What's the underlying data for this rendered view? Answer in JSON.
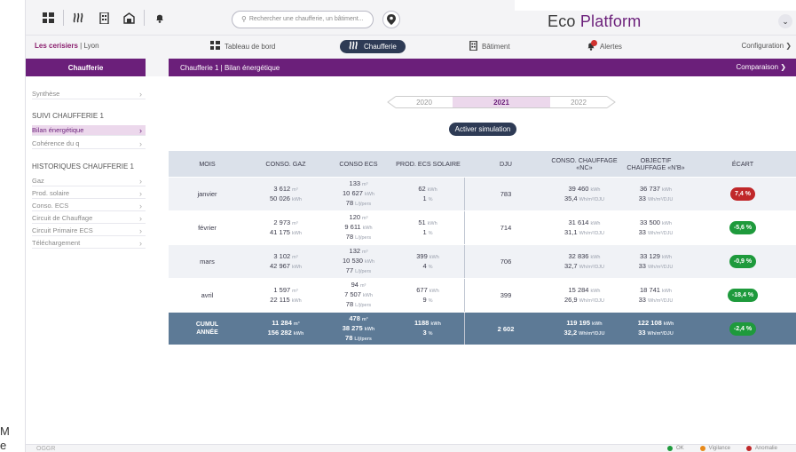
{
  "left_fragment": {
    "line1": "M",
    "line2": "e"
  },
  "topbar": {
    "search_placeholder": "Rechercher une chaufferie, un bâtiment...",
    "brand_eco": "Eco",
    "brand_platform": "Platform"
  },
  "navbar": {
    "site_name": "Les cerisiers",
    "site_city": "| Lyon",
    "items": [
      {
        "label": "Tableau de bord"
      },
      {
        "label": "Chaufferie"
      },
      {
        "label": "Bâtiment"
      },
      {
        "label": "Alertes"
      }
    ],
    "config_label": "Configuration"
  },
  "sidebar": {
    "header": "Chaufferie",
    "synthese": "Synthèse",
    "suivi_head": "SUIVI CHAUFFERIE 1",
    "bilan": "Bilan énergétique",
    "coherence": "Cohérence du q",
    "hist_head": "HISTORIQUES CHAUFFERIE 1",
    "hist_items": [
      "Gaz",
      "Prod. solaire",
      "Conso. ECS",
      "Circuit de Chauffage",
      "Circuit Primaire ECS",
      "Téléchargement"
    ]
  },
  "main": {
    "title": "Chaufferie 1 | Bilan énergétique",
    "compare": "Comparaison",
    "years": [
      "2020",
      "2021",
      "2022"
    ],
    "simulate": "Activer simulation"
  },
  "table": {
    "headers": [
      "MOIS",
      "CONSO. GAZ",
      "CONSO ECS",
      "PROD. ECS SOLAIRE",
      "DJU",
      "CONSO. CHAUFFAGE «NC»",
      "OBJECTIF CHAUFFAGE «N'B»",
      "ÉCART"
    ],
    "rows": [
      {
        "mois": "janvier",
        "gaz_m3": "3 612",
        "gaz_kwh": "50 026",
        "ecs_m3": "133",
        "ecs_kwh": "10 627",
        "ecs_lj": "78",
        "sol_kwh": "62",
        "sol_pct": "1",
        "dju": "783",
        "nc_kwh": "39 460",
        "nc_ratio": "35,4",
        "nb_kwh": "36 737",
        "nb_ratio": "33",
        "ecart": "7,4 %",
        "ecart_color": "#c0282a"
      },
      {
        "mois": "février",
        "gaz_m3": "2 973",
        "gaz_kwh": "41 175",
        "ecs_m3": "120",
        "ecs_kwh": "9 611",
        "ecs_lj": "78",
        "sol_kwh": "51",
        "sol_pct": "1",
        "dju": "714",
        "nc_kwh": "31 614",
        "nc_ratio": "31,1",
        "nb_kwh": "33 500",
        "nb_ratio": "33",
        "ecart": "-5,6 %",
        "ecart_color": "#1e9a3c"
      },
      {
        "mois": "mars",
        "gaz_m3": "3 102",
        "gaz_kwh": "42 967",
        "ecs_m3": "132",
        "ecs_kwh": "10 530",
        "ecs_lj": "77",
        "sol_kwh": "399",
        "sol_pct": "4",
        "dju": "706",
        "nc_kwh": "32 836",
        "nc_ratio": "32,7",
        "nb_kwh": "33 129",
        "nb_ratio": "33",
        "ecart": "-0,9 %",
        "ecart_color": "#1e9a3c"
      },
      {
        "mois": "avril",
        "gaz_m3": "1 597",
        "gaz_kwh": "22 115",
        "ecs_m3": "94",
        "ecs_kwh": "7 507",
        "ecs_lj": "78",
        "sol_kwh": "677",
        "sol_pct": "9",
        "dju": "399",
        "nc_kwh": "15 284",
        "nc_ratio": "26,9",
        "nb_kwh": "18 741",
        "nb_ratio": "33",
        "ecart": "-18,4 %",
        "ecart_color": "#1e9a3c"
      }
    ],
    "cumul": {
      "mois_l1": "CUMUL",
      "mois_l2": "ANNÉE",
      "gaz_m3": "11 284",
      "gaz_kwh": "156 282",
      "ecs_m3": "478",
      "ecs_kwh": "38 275",
      "ecs_lj": "78",
      "sol_kwh": "1188",
      "sol_pct": "3",
      "dju": "2 602",
      "nc_kwh": "119 195",
      "nc_ratio": "32,2",
      "nb_kwh": "122 108",
      "nb_ratio": "33",
      "ecart": "-2,4 %",
      "ecart_color": "#1e9a3c"
    },
    "units": {
      "m3": "m³",
      "kwh": "kWh",
      "lj": "L/j/pers",
      "pct": "%",
      "ratio": "Wh/m²/DJU"
    }
  },
  "footer": {
    "code": "OGGR",
    "legend": [
      {
        "label": "OK",
        "color": "#1e9a3c"
      },
      {
        "label": "Vigilance",
        "color": "#e88a1a"
      },
      {
        "label": "Anomalie",
        "color": "#c0282a"
      }
    ]
  }
}
